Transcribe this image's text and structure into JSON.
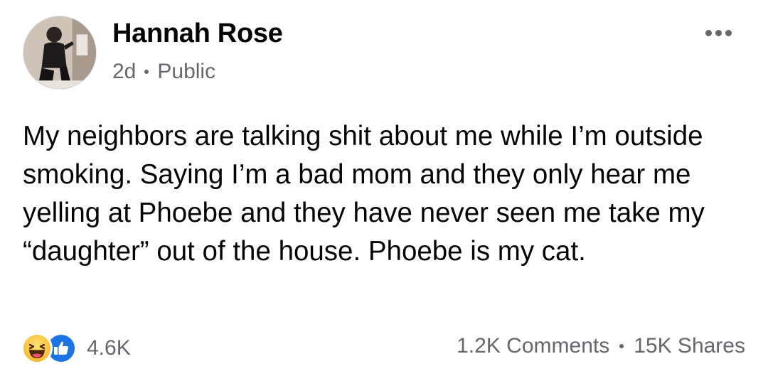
{
  "post": {
    "author": "Hannah Rose",
    "time": "2d",
    "audience": "Public",
    "text": "My neighbors are talking shit about me while I’m outside smoking. Saying I’m a bad mom and they only hear me yelling at Phoebe and they have never seen me take my “daughter” out of the house. Phoebe is my cat."
  },
  "engagement": {
    "reactions": [
      "haha-icon",
      "like-icon"
    ],
    "reaction_count": "4.6K",
    "comments": "1.2K Comments",
    "shares": "15K Shares"
  },
  "icons": {
    "more": "more-options-icon",
    "audience": "public-icon"
  },
  "colors": {
    "text": "#050505",
    "secondary": "#65676b",
    "like_blue": "#1b74e4",
    "haha_yellow": "#fbc33a"
  }
}
